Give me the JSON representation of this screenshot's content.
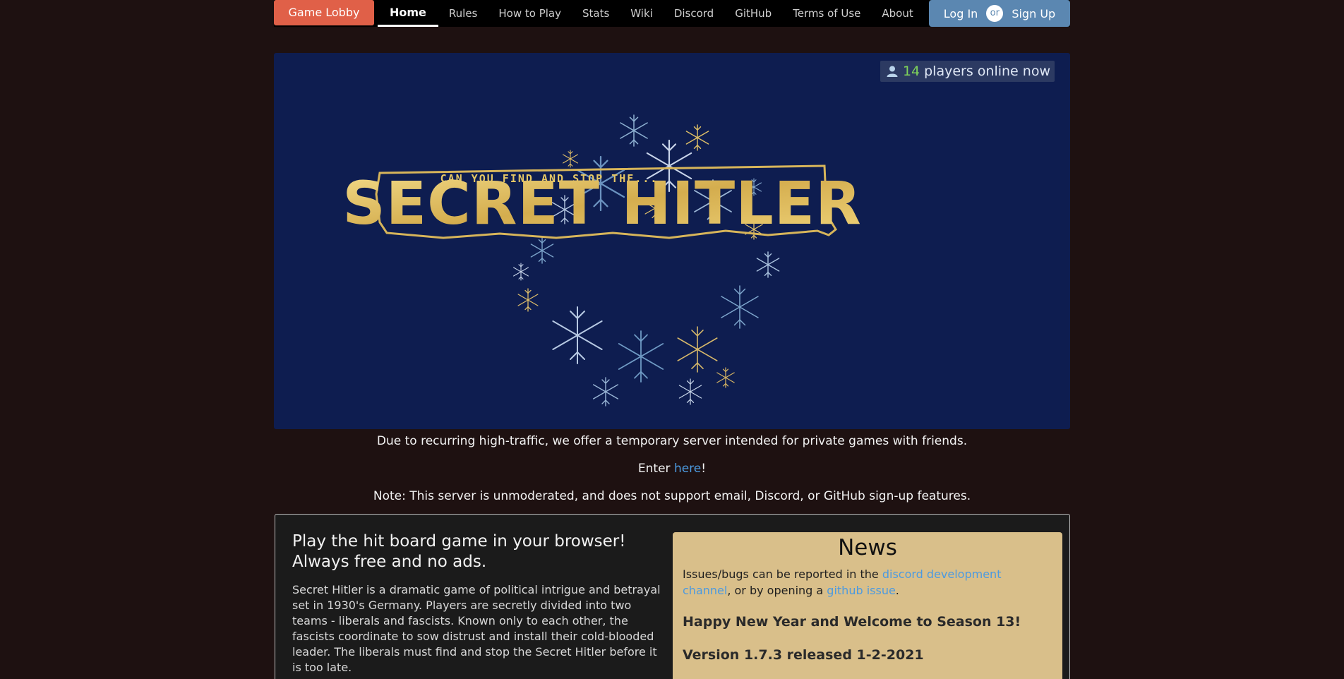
{
  "nav": {
    "lobby_label": "Game Lobby",
    "links": [
      "Home",
      "Rules",
      "How to Play",
      "Stats",
      "Wiki",
      "Discord",
      "GitHub",
      "Terms of Use",
      "About"
    ],
    "login_label": "Log In",
    "or_label": "or",
    "signup_label": "Sign Up"
  },
  "hero": {
    "online_count": "14",
    "online_suffix": "players online now",
    "tagline": "CAN YOU FIND AND STOP THE...",
    "logo_text": "SECRET HITLER"
  },
  "notice": {
    "line1": "Due to recurring high-traffic, we offer a temporary server intended for private games with friends.",
    "line2_prefix": "Enter ",
    "line2_link": "here",
    "line2_suffix": "!",
    "line3": "Note: This server is unmoderated, and does not support email, Discord, or GitHub sign-up features."
  },
  "intro": {
    "heading": "Play the hit board game in your browser! Always free and no ads.",
    "body": "Secret Hitler is a dramatic game of political intrigue and betrayal set in 1930's Germany. Players are secretly divided into two teams - liberals and fascists. Known only to each other, the fascists coordinate to sow distrust and install their cold-blooded leader. The liberals must find and stop the Secret Hitler before it is too late."
  },
  "news": {
    "title": "News",
    "issues_prefix": "Issues/bugs can be reported in the ",
    "issues_link1": "discord development channel",
    "issues_mid": ", or by opening a ",
    "issues_link2": "github issue",
    "issues_suffix": ".",
    "headline": "Happy New Year and Welcome to Season 13!",
    "version": "Version 1.7.3 released 1-2-2021"
  },
  "colors": {
    "background": "#1e1111",
    "lobby_button": "#e06048",
    "auth_button": "#5b87b1",
    "hero_background": "#0e1d50",
    "logo_gold": "#e6c765",
    "news_background": "#d9bf8a",
    "link": "#4c9ae0",
    "online_count": "#7fd35a"
  }
}
